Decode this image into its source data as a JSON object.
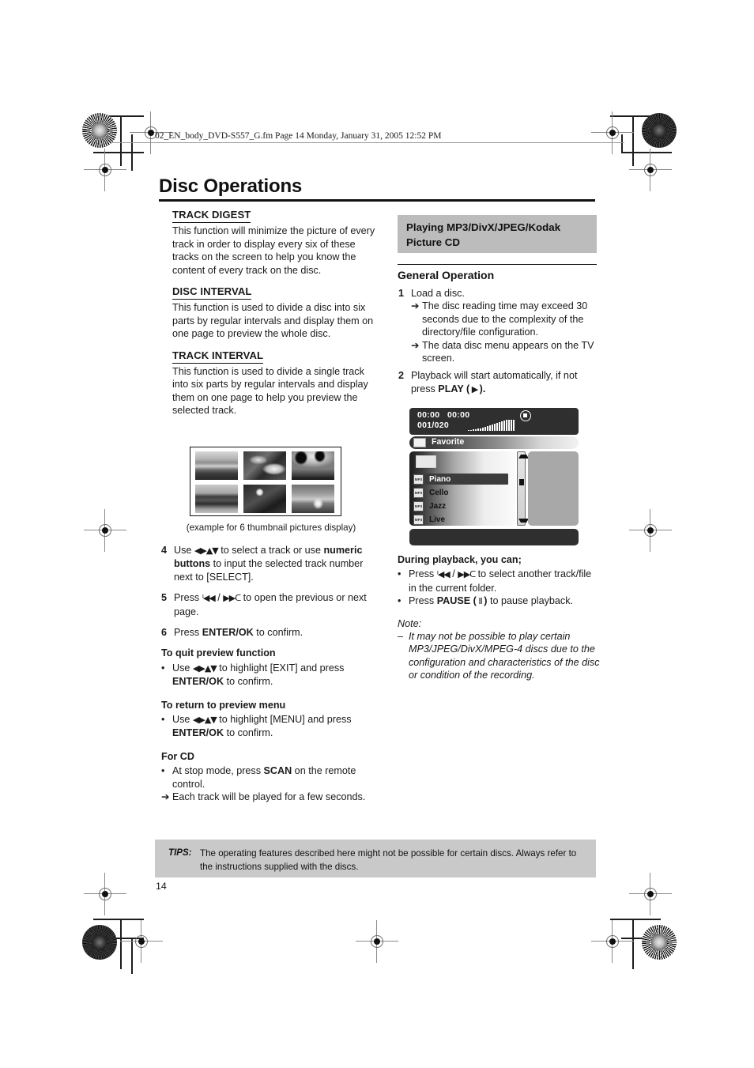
{
  "meta": {
    "slug": "02_EN_body_DVD-S557_G.fm  Page 14  Monday, January 31, 2005  12:52 PM",
    "page_number": "14"
  },
  "header": {
    "title": "Disc Operations"
  },
  "left_column": {
    "sections": [
      {
        "heading": "TRACK DIGEST",
        "body": "This function will minimize the picture of every track in order to display every six of these tracks on the screen to help you know the content of every track on the disc."
      },
      {
        "heading": "DISC INTERVAL",
        "body": "This function is used to divide a disc into six parts by regular intervals and display them on one page to preview the whole disc."
      },
      {
        "heading": "TRACK INTERVAL",
        "body": "This function is used to divide a single track into six parts by regular intervals and display them on one page to help you preview the selected track."
      }
    ],
    "figure": {
      "caption": "(example for 6 thumbnail pictures display)",
      "thumbnails": [
        "seascape-horizon",
        "rocky-coastline",
        "palm-trees-silhouette",
        "mountain-lake-reflection",
        "tree-backlit-sun",
        "sunset-over-water"
      ]
    },
    "steps": [
      {
        "num": "4",
        "parts": [
          {
            "t": "Use "
          },
          {
            "t": "◀▶▲▼",
            "style": "glyph"
          },
          {
            "t": " to select a track or use "
          },
          {
            "t": "numeric buttons",
            "style": "bold"
          },
          {
            "t": " to input the selected track number next to [SELECT]."
          }
        ]
      },
      {
        "num": "5",
        "parts": [
          {
            "t": "Press "
          },
          {
            "t": "ᑊ◀◀",
            "style": "glyph"
          },
          {
            "t": " / "
          },
          {
            "t": "▶▶ᑕ",
            "style": "glyph"
          },
          {
            "t": " to open the previous or next page."
          }
        ]
      },
      {
        "num": "6",
        "parts": [
          {
            "t": "Press "
          },
          {
            "t": "ENTER/OK",
            "style": "bold"
          },
          {
            "t": " to confirm."
          }
        ]
      }
    ],
    "subsections": [
      {
        "heading": "To quit preview function",
        "bullets": [
          [
            {
              "t": "Use "
            },
            {
              "t": "◀▶▲▼",
              "style": "glyph"
            },
            {
              "t": " to highlight [EXIT] and press "
            },
            {
              "t": "ENTER/OK",
              "style": "bold"
            },
            {
              "t": " to confirm."
            }
          ]
        ]
      },
      {
        "heading": "To return to preview menu",
        "bullets": [
          [
            {
              "t": "Use "
            },
            {
              "t": "◀▶▲▼",
              "style": "glyph"
            },
            {
              "t": " to highlight [MENU] and press "
            },
            {
              "t": "ENTER/OK",
              "style": "bold"
            },
            {
              "t": " to confirm."
            }
          ]
        ]
      },
      {
        "heading": "For CD",
        "bullets": [
          [
            {
              "t": "At stop mode, press "
            },
            {
              "t": "SCAN",
              "style": "bold"
            },
            {
              "t": " on the remote control."
            }
          ]
        ],
        "arrows": [
          [
            {
              "t": "Each track will be played for a few seconds."
            }
          ]
        ]
      }
    ]
  },
  "right_column": {
    "band_title": "Playing MP3/DivX/JPEG/Kodak Picture CD",
    "general_operation_heading": "General Operation",
    "steps": [
      {
        "num": "1",
        "parts": [
          {
            "t": "Load a disc."
          }
        ],
        "arrows": [
          [
            {
              "t": "The disc reading time may exceed 30 seconds due to the complexity of the directory/file configuration."
            }
          ],
          [
            {
              "t": "The data disc menu appears on the TV screen."
            }
          ]
        ]
      },
      {
        "num": "2",
        "parts": [
          {
            "t": "Playback will start automatically, if not press "
          },
          {
            "t": "PLAY (",
            "style": "bold"
          },
          {
            "t": " ▶ ",
            "style": "glyph"
          },
          {
            "t": ").",
            "style": "bold"
          }
        ]
      }
    ],
    "during_playback": {
      "heading": "During playback, you can;",
      "bullets": [
        [
          {
            "t": "Press "
          },
          {
            "t": "ᑊ◀◀",
            "style": "glyph"
          },
          {
            "t": " / "
          },
          {
            "t": "▶▶ᑕ",
            "style": "glyph"
          },
          {
            "t": " to select another track/file in the current folder."
          }
        ],
        [
          {
            "t": "Press "
          },
          {
            "t": "PAUSE (",
            "style": "bold"
          },
          {
            "t": " Ⅱ ",
            "style": "glyph"
          },
          {
            "t": ")",
            "style": "bold"
          },
          {
            "t": " to pause playback."
          }
        ]
      ]
    },
    "note": {
      "label": "Note:",
      "items": [
        "It may not be possible to play certain MP3/JPEG/DivX/MPEG-4 discs due to the configuration and characteristics of the disc or condition of the recording."
      ]
    }
  },
  "osd": {
    "elapsed_time": "00:00",
    "total_time": "00:00",
    "track_counter": "001/020",
    "status_icon": "stop-icon",
    "level_meter_bars": [
      1,
      1,
      2,
      2,
      3,
      3,
      4,
      5,
      6,
      7,
      8,
      9,
      10,
      11,
      12,
      13,
      14,
      14,
      14,
      14
    ],
    "folder_label": "Favorite",
    "files": [
      {
        "label": "",
        "type": "folder",
        "selected": false
      },
      {
        "label": "Piano",
        "type": "mp3",
        "selected": true
      },
      {
        "label": "Cello",
        "type": "mp3",
        "selected": false
      },
      {
        "label": "Jazz",
        "type": "mp3",
        "selected": false
      },
      {
        "label": "Live",
        "type": "mp3",
        "selected": false
      }
    ],
    "file_type_badge": "MP3"
  },
  "tips": {
    "label": "TIPS:",
    "text": "The operating features described here might not be possible for certain discs. Always refer to the instructions supplied with the discs."
  }
}
